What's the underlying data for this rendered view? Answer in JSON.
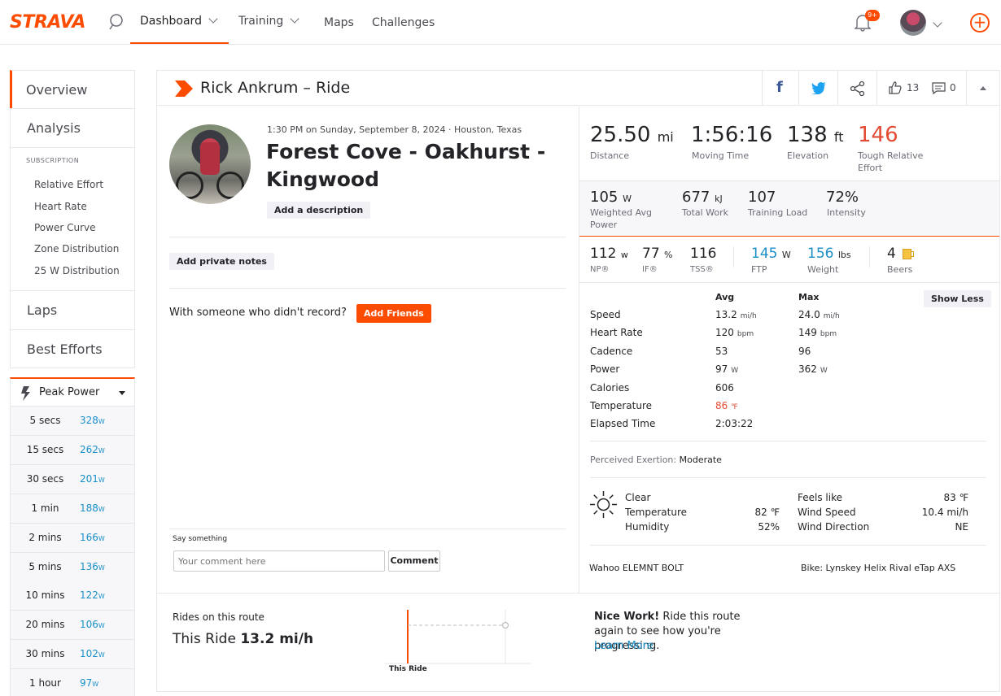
{
  "nav": {
    "logo": "STRAVA",
    "items": [
      "Dashboard",
      "Training",
      "Maps",
      "Challenges"
    ],
    "notifications_badge": "9+"
  },
  "sidebar": {
    "overview": "Overview",
    "analysis": "Analysis",
    "subscription_label": "SUBSCRIPTION",
    "sub_items": [
      "Relative Effort",
      "Heart Rate",
      "Power Curve",
      "Zone Distribution",
      "25 W Distribution"
    ],
    "laps": "Laps",
    "best_efforts": "Best Efforts",
    "peak_power": {
      "title": "Peak Power",
      "unit": "W",
      "rows": [
        {
          "label": "5 secs",
          "value": "328"
        },
        {
          "label": "15 secs",
          "value": "262"
        },
        {
          "label": "30 secs",
          "value": "201"
        },
        {
          "label": "1 min",
          "value": "188"
        },
        {
          "label": "2 mins",
          "value": "166"
        },
        {
          "label": "5 mins",
          "value": "136"
        },
        {
          "label": "10 mins",
          "value": "122"
        },
        {
          "label": "20 mins",
          "value": "106"
        },
        {
          "label": "30 mins",
          "value": "102"
        },
        {
          "label": "1 hour",
          "value": "97"
        }
      ]
    }
  },
  "header": {
    "title": "Rick Ankrum – Ride",
    "kudos_count": "13",
    "comment_count": "0"
  },
  "activity": {
    "datetime": "1:30 PM on Sunday, September 8, 2024 · Houston, Texas",
    "name": "Forest Cove - Oakhurst - Kingwood",
    "add_description": "Add a description",
    "add_private_notes": "Add private notes",
    "with_someone": "With someone who didn't record?",
    "add_friends": "Add Friends",
    "say_something": "Say something",
    "comment_placeholder": "Your comment here",
    "comment_button": "Comment"
  },
  "primary_stats": [
    {
      "value": "25.50",
      "unit": "mi",
      "label": "Distance"
    },
    {
      "value": "1:56:16",
      "unit": "",
      "label": "Moving Time"
    },
    {
      "value": "138",
      "unit": "ft",
      "label": "Elevation"
    },
    {
      "value": "146",
      "unit": "",
      "label": "Tough Relative Effort",
      "color": "#e34a33"
    }
  ],
  "secondary_stats": [
    {
      "value": "105",
      "unit": "W",
      "label": "Weighted Avg Power"
    },
    {
      "value": "677",
      "unit": "kJ",
      "label": "Total Work"
    },
    {
      "value": "107",
      "unit": "",
      "label": "Training Load"
    },
    {
      "value": "72%",
      "unit": "",
      "label": "Intensity"
    }
  ],
  "tertiary_stats": [
    {
      "value": "112",
      "unit": "w",
      "label": "NP®"
    },
    {
      "value": "77",
      "unit": "%",
      "label": "IF®"
    },
    {
      "value": "116",
      "unit": "",
      "label": "TSS®"
    },
    {
      "value": "145",
      "unit": "W",
      "label": "FTP",
      "color": "#1a8fc7"
    },
    {
      "value": "156",
      "unit": "lbs",
      "label": "Weight",
      "color": "#1a8fc7"
    },
    {
      "value": "4",
      "unit": "",
      "label": "Beers"
    }
  ],
  "details": {
    "avg_header": "Avg",
    "max_header": "Max",
    "show_less": "Show Less",
    "rows": [
      {
        "label": "Speed",
        "avg": "13.2",
        "avg_unit": "mi/h",
        "max": "24.0",
        "max_unit": "mi/h"
      },
      {
        "label": "Heart Rate",
        "avg": "120",
        "avg_unit": "bpm",
        "max": "149",
        "max_unit": "bpm"
      },
      {
        "label": "Cadence",
        "avg": "53",
        "avg_unit": "",
        "max": "96",
        "max_unit": ""
      },
      {
        "label": "Power",
        "avg": "97",
        "avg_unit": "W",
        "max": "362",
        "max_unit": "W"
      },
      {
        "label": "Calories",
        "avg": "606",
        "avg_unit": "",
        "max": "",
        "max_unit": ""
      },
      {
        "label": "Temperature",
        "avg": "86",
        "avg_unit": "℉",
        "max": "",
        "max_unit": "",
        "color": "#e34a33"
      },
      {
        "label": "Elapsed Time",
        "avg": "2:03:22",
        "avg_unit": "",
        "max": "",
        "max_unit": ""
      }
    ],
    "perceived_label": "Perceived Exertion:",
    "perceived_value": "Moderate"
  },
  "weather": {
    "condition": "Clear",
    "temperature_label": "Temperature",
    "temperature": "82 ℉",
    "humidity_label": "Humidity",
    "humidity": "52%",
    "feels_like_label": "Feels like",
    "feels_like": "83 ℉",
    "wind_speed_label": "Wind Speed",
    "wind_speed": "10.4 mi/h",
    "wind_direction_label": "Wind Direction",
    "wind_direction": "NE"
  },
  "device": "Wahoo ELEMNT BOLT",
  "bike": "Bike: Lynskey Helix Rival eTap AXS",
  "route": {
    "title": "Rides on this route",
    "this_ride_label": "This Ride",
    "this_ride_speed": "13.2 mi/h",
    "chart_label": "This Ride",
    "nice_work": "Nice Work!",
    "message": " Ride this route again to see how you're progressing.",
    "learn_more": "Learn More"
  }
}
